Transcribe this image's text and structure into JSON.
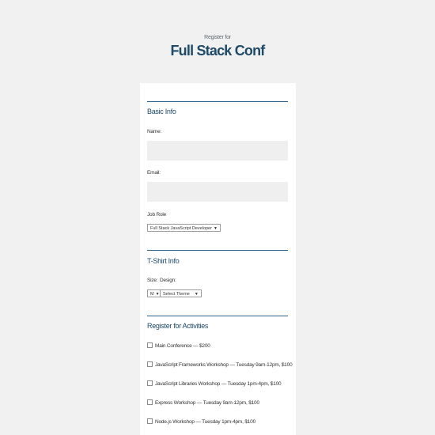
{
  "header": {
    "kicker": "Register for",
    "title": "Full Stack Conf"
  },
  "basic_info": {
    "title": "Basic Info",
    "name_label": "Name:",
    "name_value": "",
    "email_label": "Email:",
    "email_value": "",
    "job_role_label": "Job Role",
    "job_role_selected": "Full Stack JavaScript Developer"
  },
  "tshirt": {
    "title": "T-Shirt Info",
    "size_label": "Size:",
    "size_selected": "M",
    "design_label": "Design:",
    "design_selected": "Select Theme"
  },
  "activities": {
    "title": "Register for Activities",
    "items": [
      {
        "label": "Main Conference — $200",
        "checked": false
      },
      {
        "label": "JavaScript Frameworks Workshop — Tuesday 9am-12pm, $100",
        "checked": false
      },
      {
        "label": "JavaScript Libraries Workshop — Tuesday 1pm-4pm, $100",
        "checked": false
      },
      {
        "label": "Express Workshop — Tuesday 9am-12pm, $100",
        "checked": false
      },
      {
        "label": "Node.js Workshop — Tuesday 1pm-4pm, $100",
        "checked": false
      }
    ]
  },
  "colors": {
    "background": "#f1f1f1",
    "card": "#ffffff",
    "accent": "#2b5f86",
    "title": "#1f4a68",
    "input": "#efefef"
  },
  "icons": {
    "select_arrow": "chevron-down-icon",
    "checkbox": "checkbox-icon"
  }
}
